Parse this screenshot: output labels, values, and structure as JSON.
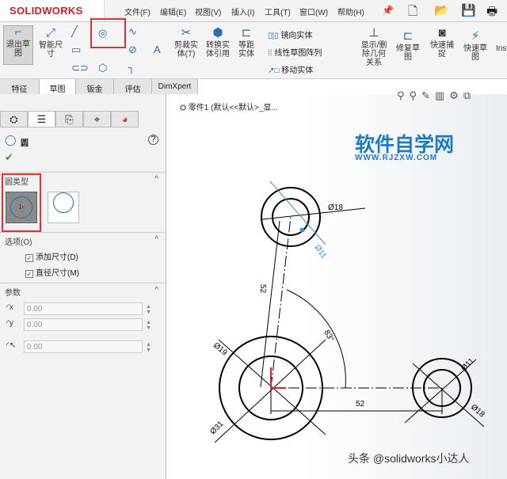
{
  "app": {
    "logo": "SOLIDWORKS"
  },
  "menu": [
    "文件(F)",
    "编辑(E)",
    "视图(V)",
    "插入(I)",
    "工具(T)",
    "窗口(W)",
    "帮助(H)"
  ],
  "ribbon": {
    "exit_sketch": "退出草图",
    "smart_dim": "智能尺寸",
    "trim": "剪裁实体(T)",
    "convert": "转换实体引用",
    "offset": "等距实体",
    "mirror": "镜向实体",
    "linear_pattern": "线性草图阵列",
    "move": "移动实体",
    "show_delete": "显示/删除几何关系",
    "repair": "修复草图",
    "quick_snap": "快速捕捉",
    "rapid_sketch": "快速草图",
    "instant": "Inst"
  },
  "tabs": [
    "特征",
    "草图",
    "钣金",
    "评估",
    "DimXpert"
  ],
  "panel": {
    "title": "圆",
    "circle_type_label": "圆类型",
    "options_label": "选项(O)",
    "add_dim": "添加尺寸(D)",
    "diameter_dim": "直径尺寸(M)",
    "params_label": "参数",
    "cx": "0.00",
    "cy": "0.00",
    "radius": "0.00",
    "help": "?"
  },
  "canvas": {
    "tree_item": "零件1  (默认<<默认>_显...",
    "watermark_title": "软件自学网",
    "watermark_url": "WWW.RJZXW.COM",
    "footer_credit": "头条 @solidworks小达人",
    "dims": {
      "top_outer": "Ø18",
      "top_inner": "Ø11",
      "left_len": "52",
      "angle": "83°",
      "big_inner": "Ø19",
      "big_outer": "Ø31",
      "bottom_len": "52",
      "right_inner": "Ø11",
      "right_outer": "Ø18"
    }
  },
  "colors": {
    "accent": "#2a6db0",
    "highlight": "#e03030",
    "watermark": "#1f7ac4"
  }
}
